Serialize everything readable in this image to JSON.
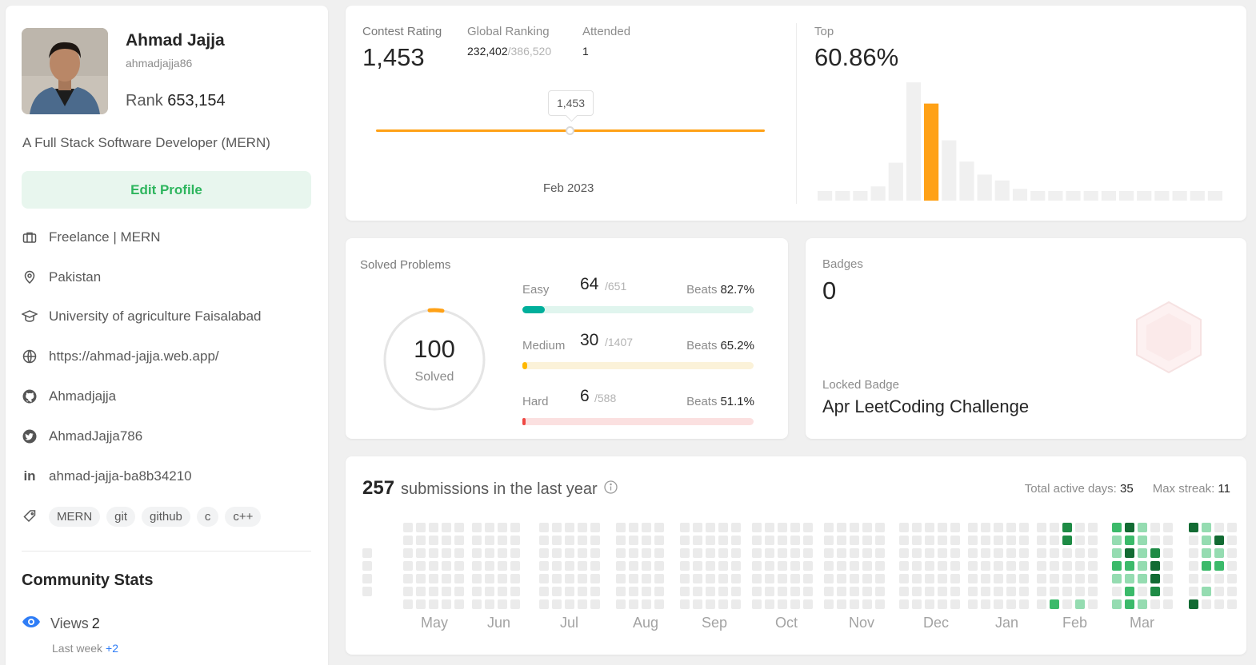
{
  "profile": {
    "name": "Ahmad Jajja",
    "username": "ahmadjajja86",
    "rank_label": "Rank",
    "rank_value": "653,154",
    "bio": "A Full Stack Software Developer (MERN)",
    "edit_label": "Edit Profile",
    "work": "Freelance | MERN",
    "location": "Pakistan",
    "education": "University of agriculture Faisalabad",
    "website": "https://ahmad-jajja.web.app/",
    "github": "Ahmadjajja",
    "twitter": "AhmadJajja786",
    "linkedin": "ahmad-jajja-ba8b34210",
    "tags": [
      "MERN",
      "git",
      "github",
      "c",
      "c++"
    ]
  },
  "community": {
    "title": "Community Stats",
    "views_label": "Views",
    "views_value": "2",
    "last_week_label": "Last week",
    "last_week_delta": "+2"
  },
  "contest": {
    "rating_label": "Contest Rating",
    "rating_value": "1,453",
    "global_label": "Global Ranking",
    "global_value": "232,402",
    "global_total": "/386,520",
    "attended_label": "Attended",
    "attended_value": "1",
    "tooltip_value": "1,453",
    "date_label": "Feb 2023",
    "top_label": "Top",
    "top_value": "60.86%",
    "accent_color": "#ffa116"
  },
  "solved": {
    "title": "Solved Problems",
    "total": "100",
    "total_label": "Solved",
    "beats_label": "Beats",
    "difficulties": [
      {
        "name": "Easy",
        "solved": "64",
        "total": "/651",
        "beats": "82.7%",
        "fraction": 0.098,
        "color": "#00af9b",
        "track": "#e0f5ee"
      },
      {
        "name": "Medium",
        "solved": "30",
        "total": "/1407",
        "beats": "65.2%",
        "fraction": 0.021,
        "color": "#ffb800",
        "track": "#fbf2d9"
      },
      {
        "name": "Hard",
        "solved": "6",
        "total": "/588",
        "beats": "51.1%",
        "fraction": 0.01,
        "color": "#ef4743",
        "track": "#fbe0e0"
      }
    ]
  },
  "badges": {
    "label": "Badges",
    "count": "0",
    "locked_label": "Locked Badge",
    "locked_name": "Apr LeetCoding Challenge"
  },
  "heatmap": {
    "count": "257",
    "title": "submissions in the last year",
    "active_label": "Total active days:",
    "active_value": "35",
    "streak_label": "Max streak:",
    "streak_value": "11",
    "months": [
      "May",
      "Jun",
      "Jul",
      "Aug",
      "Sep",
      "Oct",
      "Nov",
      "Dec",
      "Jan",
      "Feb",
      "Mar"
    ],
    "colors": {
      "empty": "#ebebeb",
      "l1": "#95dcb1",
      "l2": "#3bba6a",
      "l3": "#1e8b45",
      "l4": "#126b33"
    }
  },
  "chart_data": {
    "type": "bar",
    "title": "",
    "categories": [
      "1",
      "2",
      "3",
      "4",
      "5",
      "6",
      "7",
      "8",
      "9",
      "10",
      "11",
      "12",
      "13",
      "14",
      "15",
      "16",
      "17",
      "18",
      "19",
      "20",
      "21",
      "22",
      "23"
    ],
    "values": [
      0.08,
      0.08,
      0.08,
      0.12,
      0.32,
      1.0,
      0.82,
      0.51,
      0.33,
      0.22,
      0.17,
      0.1,
      0.08,
      0.08,
      0.08,
      0.08,
      0.08,
      0.08,
      0.08,
      0.08,
      0.08,
      0.08,
      0.08
    ],
    "highlight_index": 6,
    "xlabel": "",
    "ylabel": ""
  }
}
